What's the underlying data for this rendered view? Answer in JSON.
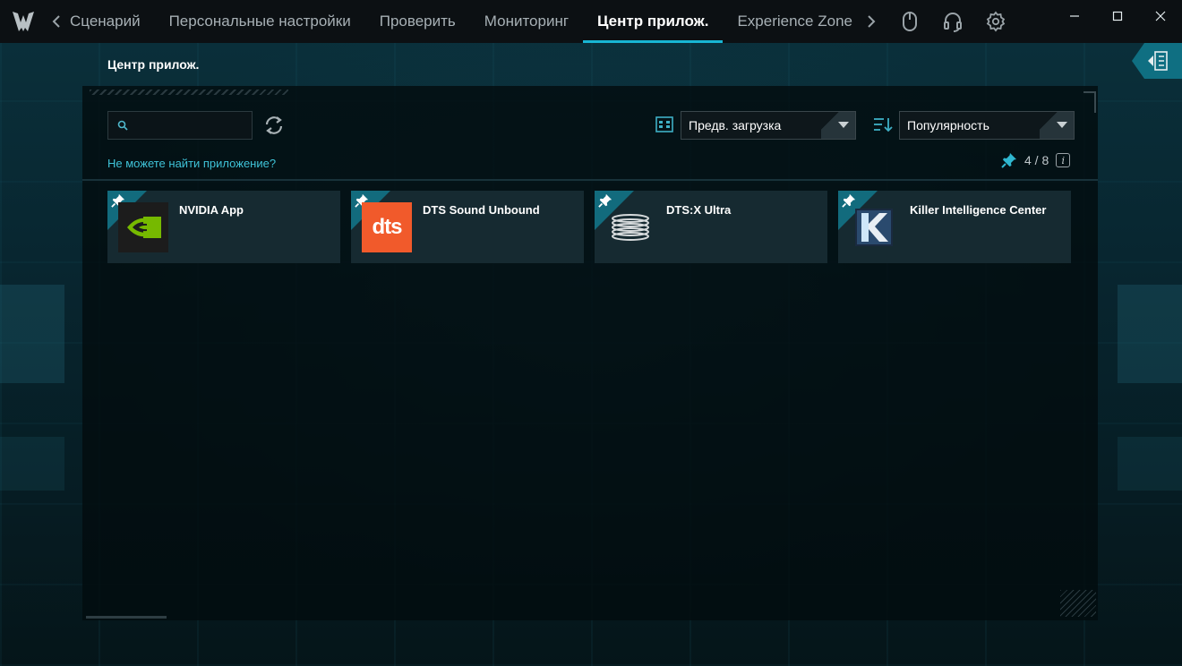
{
  "titlebar": {
    "tabs": [
      {
        "label": "Сценарий"
      },
      {
        "label": "Персональные настройки"
      },
      {
        "label": "Проверить"
      },
      {
        "label": "Мониторинг"
      },
      {
        "label": "Центр прилож.",
        "active": true
      },
      {
        "label": "Experience Zone"
      }
    ],
    "icons": [
      "mouse-icon",
      "headset-icon",
      "settings-gear-icon"
    ],
    "window_controls": [
      "minimize-icon",
      "maximize-icon",
      "close-icon"
    ]
  },
  "page": {
    "title": "Центр прилож."
  },
  "toolbar": {
    "search_value": "",
    "filter_selected": "Предв. загрузка",
    "sort_selected": "Популярность",
    "cant_find_link": "Не можете найти приложение?",
    "pin_count": "4 / 8",
    "info_glyph": "i"
  },
  "apps": [
    {
      "name": "NVIDIA App",
      "pinned": true,
      "icon": "nvidia-logo-icon"
    },
    {
      "name": "DTS Sound Unbound",
      "pinned": true,
      "icon": "dts-logo-icon",
      "logo_text": "dts"
    },
    {
      "name": "DTS:X Ultra",
      "pinned": true,
      "icon": "dtsx-ultra-icon"
    },
    {
      "name": "Killer Intelligence Center",
      "pinned": true,
      "icon": "killer-logo-icon"
    }
  ],
  "colors": {
    "accent": "#18b6d4",
    "link": "#3fc3d8",
    "card": "#162a31",
    "pin_corner": "#126b7d",
    "dts_orange": "#f15a2b",
    "nvidia_green": "#76b900"
  }
}
